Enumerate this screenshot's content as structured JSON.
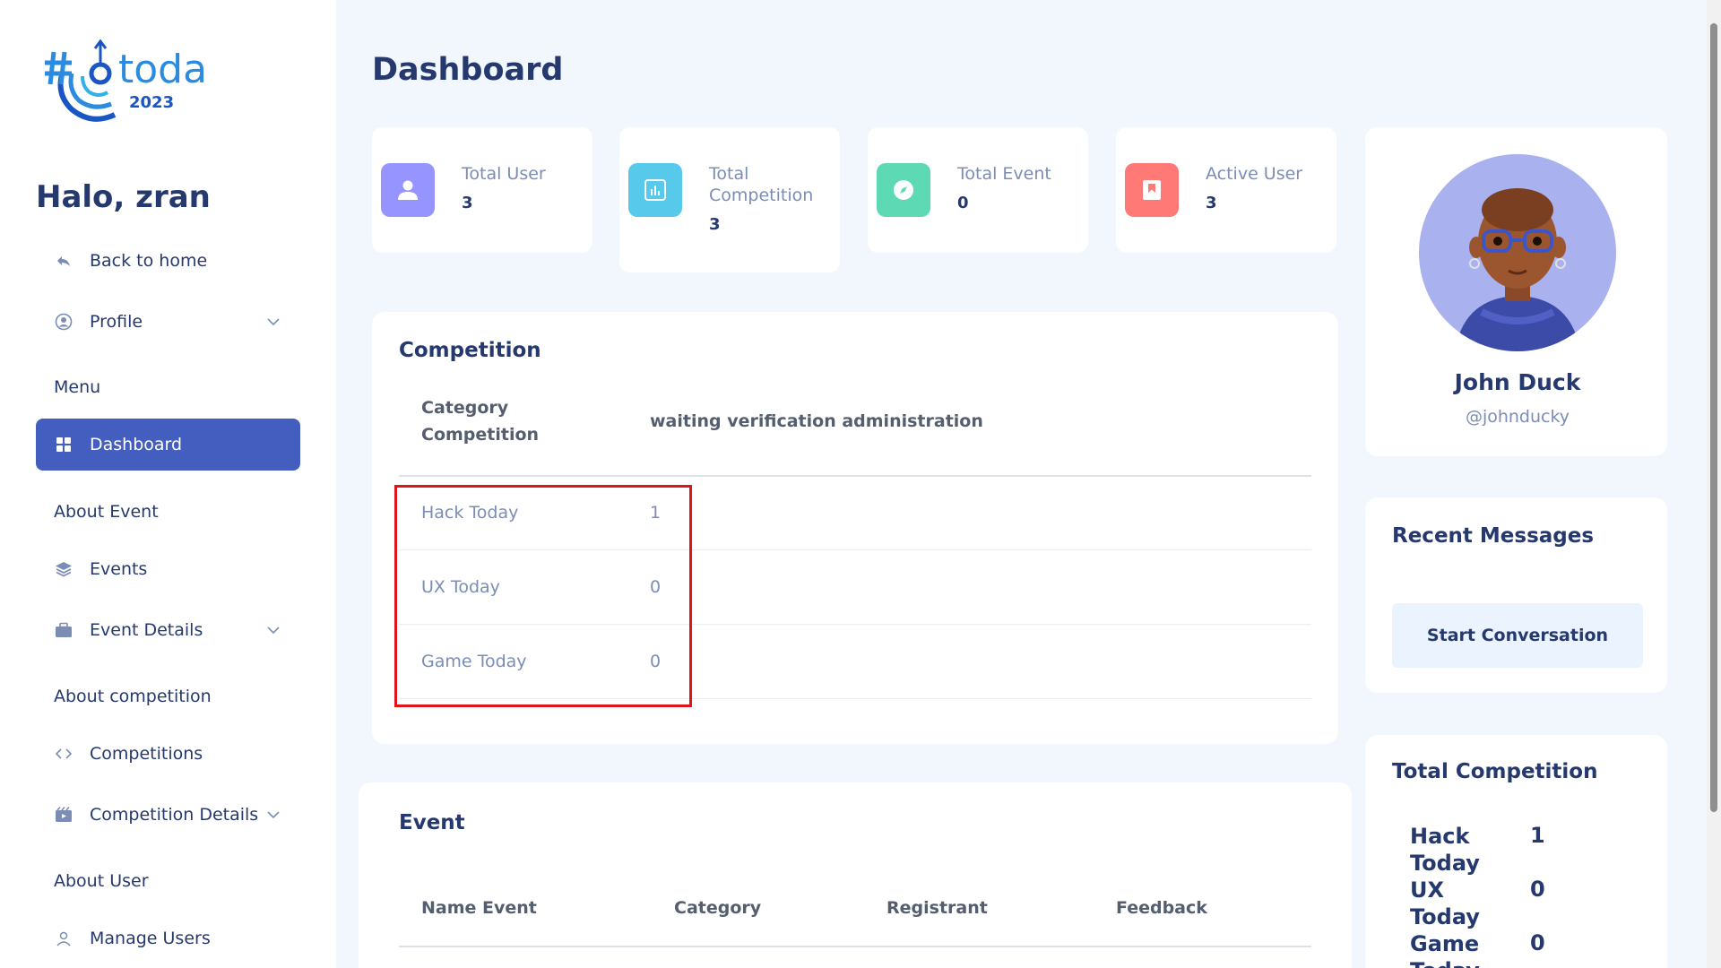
{
  "sidebar": {
    "logo_text": "today",
    "logo_year": "2023",
    "greeting": "Halo, zran",
    "back_home": "Back to home",
    "profile": "Profile",
    "menu_section": "Menu",
    "dashboard": "Dashboard",
    "about_event": "About Event",
    "events": "Events",
    "event_details": "Event Details",
    "about_competition": "About competition",
    "competitions": "Competitions",
    "competition_details": "Competition Details",
    "about_user": "About User",
    "manage_users": "Manage Users"
  },
  "page": {
    "title": "Dashboard"
  },
  "stats": [
    {
      "label": "Total User",
      "value": "3",
      "color": "#9694ff",
      "icon": "user-icon"
    },
    {
      "label": "Total Competition",
      "value": "3",
      "color": "#57caeb",
      "icon": "chart-icon"
    },
    {
      "label": "Total Event",
      "value": "0",
      "color": "#5ddab4",
      "icon": "compass-icon"
    },
    {
      "label": "Active User",
      "value": "3",
      "color": "#ff7976",
      "icon": "bookmark-icon"
    }
  ],
  "competition": {
    "title": "Competition",
    "headers": [
      "Category Competition",
      "waiting verification administration"
    ],
    "rows": [
      {
        "name": "Hack Today",
        "count": "1"
      },
      {
        "name": "UX Today",
        "count": "0"
      },
      {
        "name": "Game Today",
        "count": "0"
      }
    ]
  },
  "event": {
    "title": "Event",
    "headers": [
      "Name Event",
      "Category",
      "Registrant",
      "Feedback"
    ]
  },
  "profile": {
    "name": "John Duck",
    "username": "@johnducky"
  },
  "messages": {
    "title": "Recent Messages",
    "button": "Start Conversation"
  },
  "total_competition": {
    "title": "Total Competition",
    "rows": [
      {
        "name": "Hack Today",
        "count": "1"
      },
      {
        "name": "UX Today",
        "count": "0"
      },
      {
        "name": "Game Today",
        "count": "0"
      }
    ]
  },
  "colors": {
    "accent": "#435ebe",
    "highlight": "#e0141b"
  }
}
